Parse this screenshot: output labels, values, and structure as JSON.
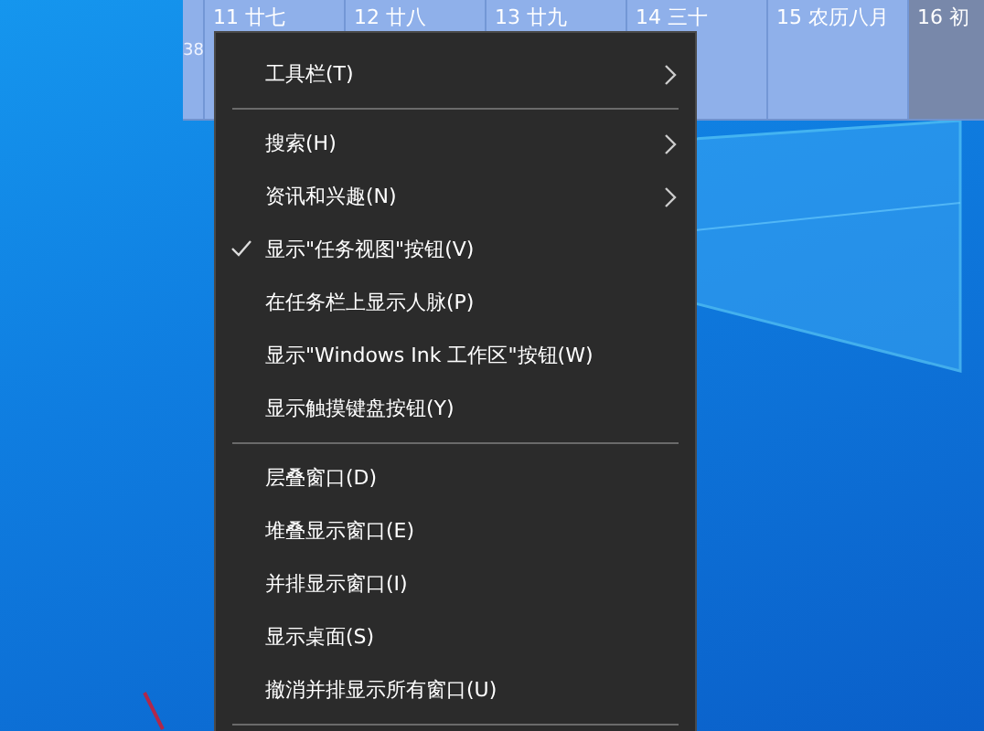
{
  "calendar": {
    "week_number": "38",
    "days": [
      {
        "label": "11 廿七",
        "selected": false
      },
      {
        "label": "12 廿八",
        "selected": false
      },
      {
        "label": "13 廿九",
        "selected": false
      },
      {
        "label": "14 三十",
        "selected": false
      },
      {
        "label": "15 农历八月",
        "selected": false
      },
      {
        "label": "16 初",
        "selected": true
      }
    ]
  },
  "context_menu": {
    "groups": [
      {
        "items": [
          {
            "label": "工具栏(T)",
            "checked": false,
            "submenu": true
          }
        ]
      },
      {
        "items": [
          {
            "label": "搜索(H)",
            "checked": false,
            "submenu": true
          },
          {
            "label": "资讯和兴趣(N)",
            "checked": false,
            "submenu": true
          },
          {
            "label": "显示\"任务视图\"按钮(V)",
            "checked": true,
            "submenu": false
          },
          {
            "label": "在任务栏上显示人脉(P)",
            "checked": false,
            "submenu": false
          },
          {
            "label": "显示\"Windows Ink 工作区\"按钮(W)",
            "checked": false,
            "submenu": false
          },
          {
            "label": "显示触摸键盘按钮(Y)",
            "checked": false,
            "submenu": false
          }
        ]
      },
      {
        "items": [
          {
            "label": "层叠窗口(D)",
            "checked": false,
            "submenu": false
          },
          {
            "label": "堆叠显示窗口(E)",
            "checked": false,
            "submenu": false
          },
          {
            "label": "并排显示窗口(I)",
            "checked": false,
            "submenu": false
          },
          {
            "label": "显示桌面(S)",
            "checked": false,
            "submenu": false
          },
          {
            "label": "撤消并排显示所有窗口(U)",
            "checked": false,
            "submenu": false
          }
        ]
      }
    ]
  }
}
